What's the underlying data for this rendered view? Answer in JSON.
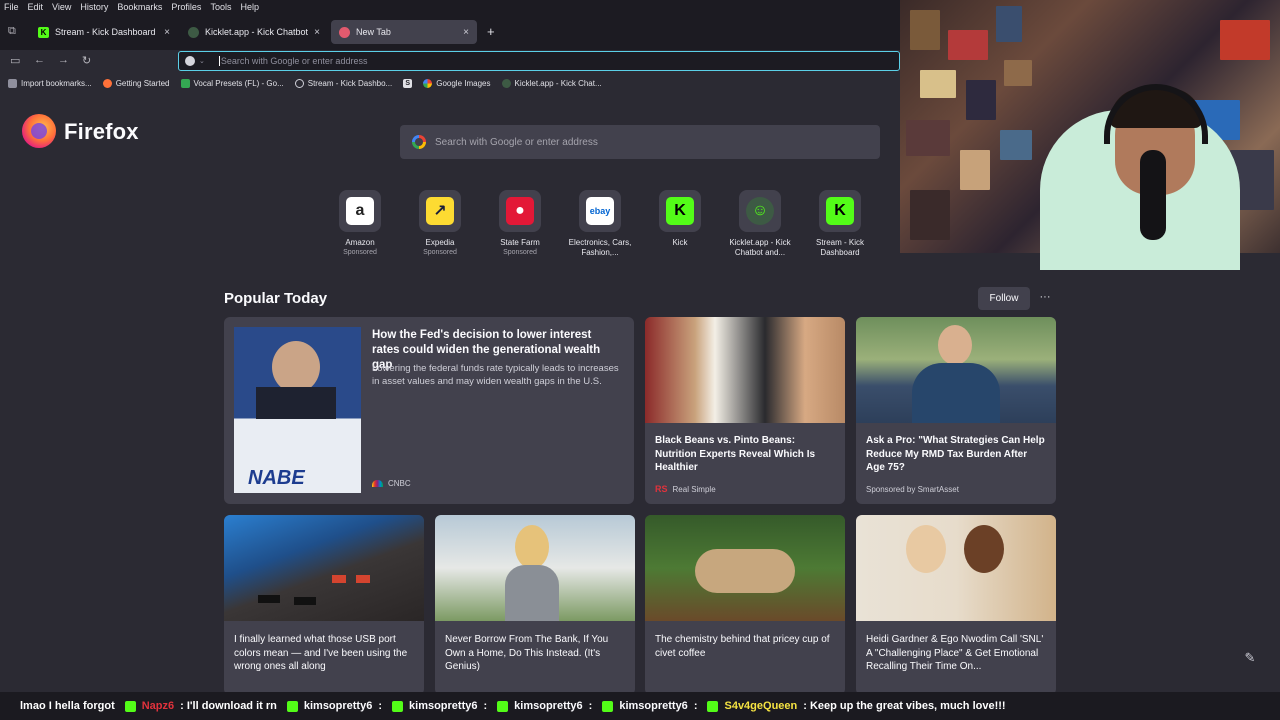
{
  "menu": [
    "File",
    "Edit",
    "View",
    "History",
    "Bookmarks",
    "Profiles",
    "Tools",
    "Help"
  ],
  "tabs": [
    {
      "title": "Stream - Kick Dashboard",
      "favicon": "kick-icon",
      "active": false
    },
    {
      "title": "Kicklet.app - Kick Chatbot and C",
      "favicon": "kicklet-icon",
      "active": false
    },
    {
      "title": "New Tab",
      "favicon": "firefox-newtab-icon",
      "active": true
    }
  ],
  "new_tab_symbol": "+",
  "close_symbol": "×",
  "urlbar": {
    "placeholder": "Search with Google or enter address",
    "value": ""
  },
  "bookmarks": [
    {
      "label": "Import bookmarks...",
      "icon": "import-icon"
    },
    {
      "label": "Getting Started",
      "icon": "firefox-icon"
    },
    {
      "label": "Vocal Presets (FL) - Go...",
      "icon": "drive-icon"
    },
    {
      "label": "Stream - Kick Dashbo...",
      "icon": "globe-icon"
    },
    {
      "label": "",
      "icon": "s-icon"
    },
    {
      "label": "Google Images",
      "icon": "google-icon"
    },
    {
      "label": "Kicklet.app - Kick Chat...",
      "icon": "kicklet-icon"
    }
  ],
  "brand": {
    "name": "Firefox"
  },
  "center_search": {
    "placeholder": "Search with Google or enter address"
  },
  "shortcuts": [
    {
      "label": "Amazon",
      "sub": "Sponsored",
      "glyph": "a",
      "bg": "#ffffff",
      "fg": "#222222"
    },
    {
      "label": "Expedia",
      "sub": "Sponsored",
      "glyph": "↗",
      "bg": "#fddb32",
      "fg": "#191e3b"
    },
    {
      "label": "State Farm",
      "sub": "Sponsored",
      "glyph": "●",
      "bg": "#e31837",
      "fg": "#ffffff"
    },
    {
      "label": "Electronics, Cars, Fashion,...",
      "sub": "",
      "glyph": "ebay",
      "bg": "#ffffff",
      "fg": "#0064d2"
    },
    {
      "label": "Kick",
      "sub": "",
      "glyph": "K",
      "bg": "#53fc18",
      "fg": "#000000"
    },
    {
      "label": "Kicklet.app - Kick Chatbot and...",
      "sub": "",
      "glyph": "☺",
      "bg": "#3d5a44",
      "fg": "#53fc18"
    },
    {
      "label": "Stream - Kick Dashboard",
      "sub": "",
      "glyph": "K",
      "bg": "#53fc18",
      "fg": "#000000"
    }
  ],
  "popular": {
    "title": "Popular Today",
    "follow": "Follow",
    "more": "···"
  },
  "cards": [
    {
      "headline": "How the Fed's decision to lower interest rates could widen the generational wealth gap",
      "excerpt": "Lowering the federal funds rate typically leads to increases in asset values and may widen wealth gaps in the U.S.",
      "source": "CNBC"
    },
    {
      "headline": "Black Beans vs. Pinto Beans: Nutrition Experts Reveal Which Is Healthier",
      "source": "Real Simple"
    },
    {
      "headline": "Ask a Pro: \"What Strategies Can Help Reduce My RMD Tax Burden After Age 75?",
      "source": "Sponsored by SmartAsset"
    },
    {
      "headline": "I finally learned what those USB port colors mean — and I've been using the wrong ones all along"
    },
    {
      "headline": "Never Borrow From The Bank, If You Own a Home, Do This Instead. (It's Genius)"
    },
    {
      "headline": "The chemistry behind that pricey cup of civet coffee"
    },
    {
      "headline": "Heidi Gardner & Ego Nwodim Call 'SNL' A \"Challenging Place\" & Get Emotional Recalling Their Time On..."
    }
  ],
  "chat": [
    {
      "user": "",
      "msg": "lmao I hella forgot",
      "color": "#ffffff"
    },
    {
      "user": "Napz6",
      "msg": ": I'll download it rn",
      "color": "#e0323c"
    },
    {
      "user": "kimsopretty6",
      "msg": ":",
      "color": "#e8e8ee"
    },
    {
      "user": "kimsopretty6",
      "msg": ":",
      "color": "#e8e8ee"
    },
    {
      "user": "kimsopretty6",
      "msg": ":",
      "color": "#e8e8ee"
    },
    {
      "user": "kimsopretty6",
      "msg": ":",
      "color": "#e8e8ee"
    },
    {
      "user": "kimsopretty6",
      "msg": ":",
      "color": "#e8e8ee"
    },
    {
      "user": "S4v4geQueen",
      "msg": ": Keep up the great vibes, much love!!!",
      "color": "#f5e342"
    }
  ],
  "edit_icon": "pencil-icon"
}
